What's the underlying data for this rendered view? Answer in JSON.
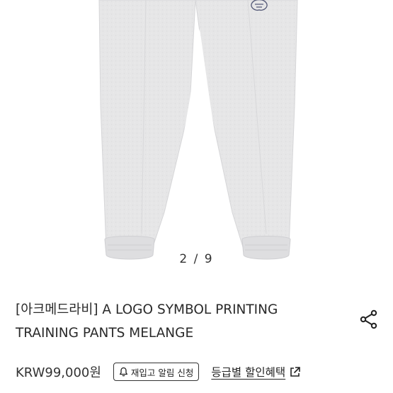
{
  "gallery": {
    "current": 2,
    "total": 9,
    "counter_text": "2 / 9",
    "colors": {
      "fabric": "#e6e6e7",
      "fabric_shadow": "#d3d3d5",
      "background": "#ffffff"
    }
  },
  "product": {
    "title_line1": "[아크메드라비] A LOGO SYMBOL PRINTING",
    "title_line2": "TRAINING PANTS MELANGE",
    "price": "KRW99,000원"
  },
  "actions": {
    "share_icon": "share-icon",
    "restock_icon": "bell-icon",
    "restock_label": "재입고 알림 신청",
    "grade_label": "등급별 할인혜택",
    "grade_icon": "external-link-icon"
  }
}
